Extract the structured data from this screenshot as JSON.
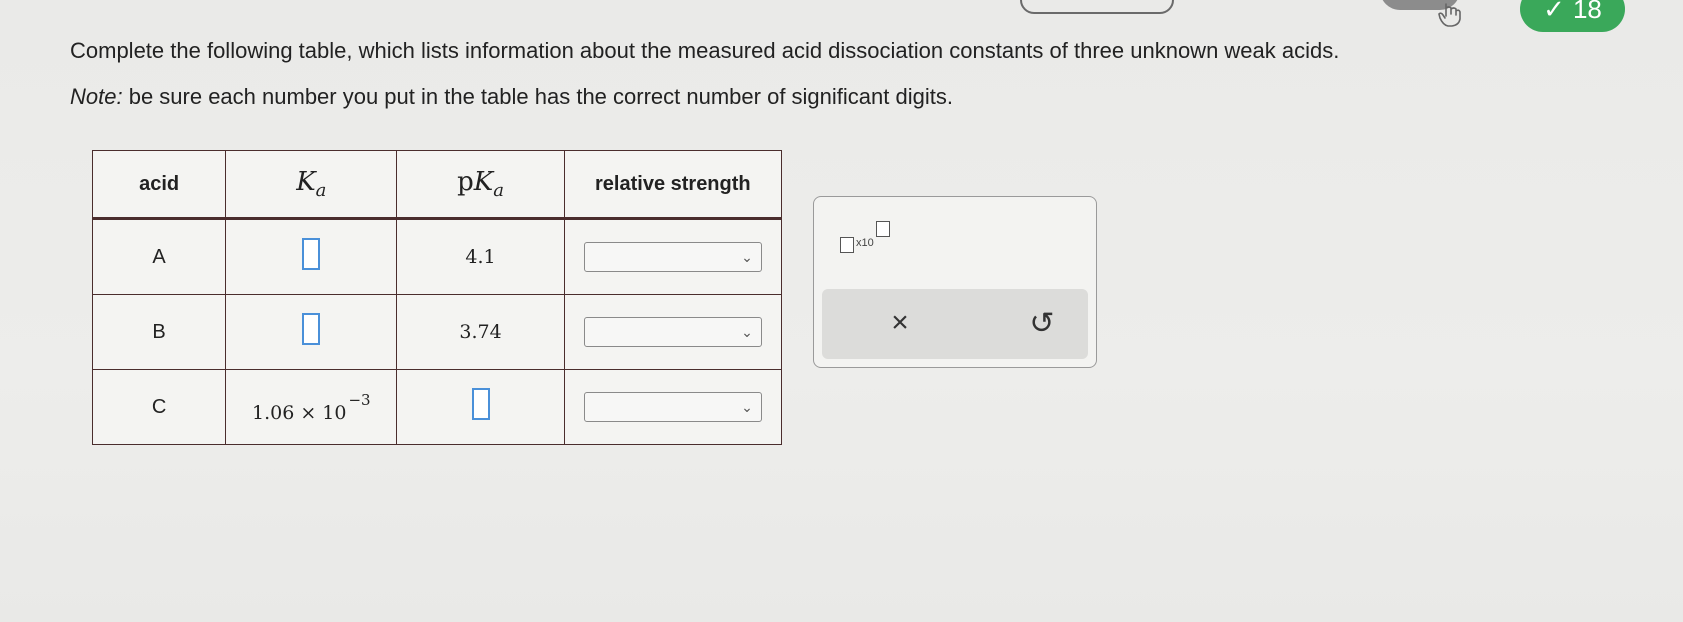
{
  "header": {
    "score": "18",
    "check_icon": "check-icon",
    "hand_icon": "pointer-hand-icon"
  },
  "instructions": {
    "prompt": "Complete the following table, which lists information about the measured acid dissociation constants of three unknown weak acids.",
    "note_label": "Note:",
    "note_text": " be sure each number you put in the table has the correct number of significant digits."
  },
  "table": {
    "headers": {
      "acid": "acid",
      "ka": "K",
      "ka_sub": "a",
      "pka_prefix": "p",
      "pka": "K",
      "pka_sub": "a",
      "relative": "relative strength"
    },
    "rows": [
      {
        "acid": "A",
        "ka": "",
        "pka": "4.1",
        "relative": ""
      },
      {
        "acid": "B",
        "ka": "",
        "pka": "3.74",
        "relative": ""
      },
      {
        "acid": "C",
        "ka_mantissa": "1.06 × 10",
        "ka_exponent": "−3",
        "pka": "",
        "relative": ""
      }
    ]
  },
  "tools": {
    "sci_label": "x10",
    "clear_symbol": "×",
    "undo_symbol": "↺"
  },
  "colors": {
    "accent": "#4a90d9",
    "score_badge": "#3aa85a",
    "table_border": "#4a2d2d"
  }
}
